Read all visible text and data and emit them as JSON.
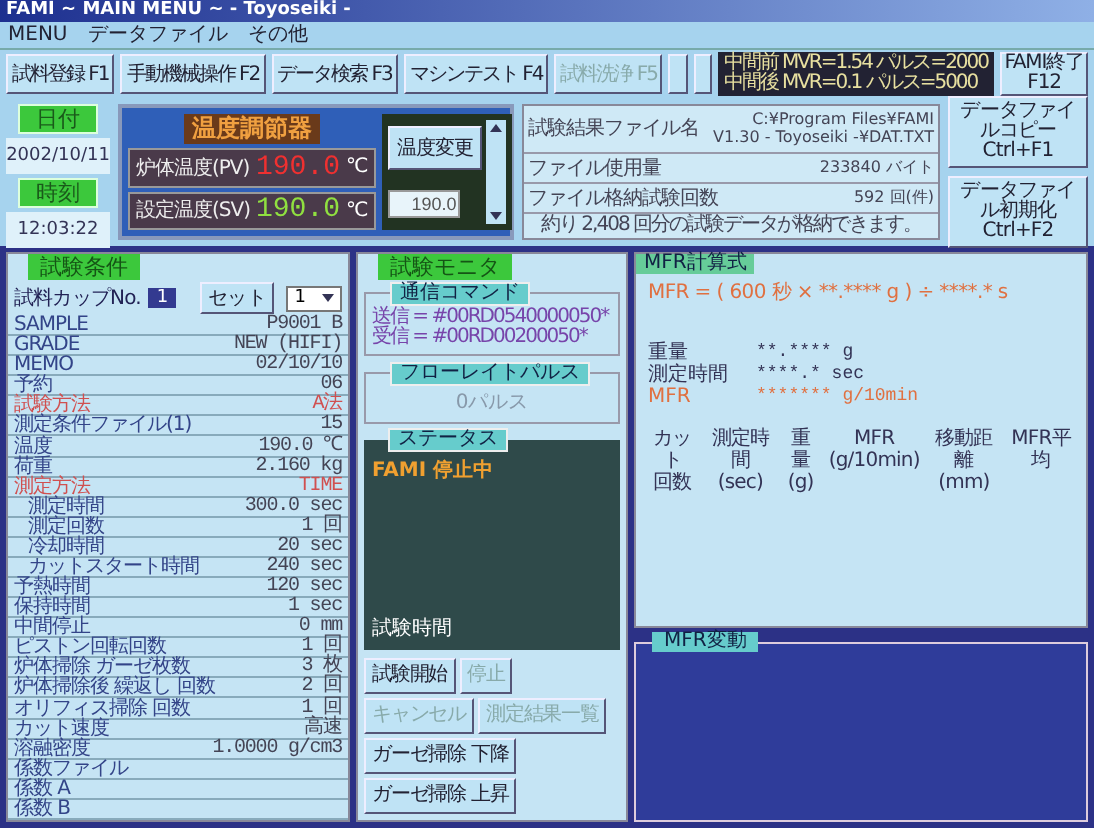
{
  "window": {
    "title": "FAMI ~ MAIN MENU ~ - Toyoseiki -"
  },
  "menu": [
    "MENU",
    "データファイル",
    "その他"
  ],
  "function_keys": [
    {
      "kind": "key",
      "label": "試料登録 F1",
      "disabled": false
    },
    {
      "kind": "key",
      "label": "手動機械操作 F2",
      "disabled": false
    },
    {
      "kind": "key",
      "label": "データ検索 F3",
      "disabled": false
    },
    {
      "kind": "key",
      "label": "マシンテスト F4",
      "disabled": false
    },
    {
      "kind": "key",
      "label": "試料洗浄 F5",
      "disabled": true
    },
    {
      "kind": "empty"
    },
    {
      "kind": "empty"
    }
  ],
  "pulse_info": [
    "中間前 MVR=1.54 パルス=2000",
    "中間後 MVR=0.1 パルス=5000"
  ],
  "exit_button": "FAMI終了 F12",
  "date": {
    "label": "日付",
    "value": "2002/10/11"
  },
  "time": {
    "label": "時刻",
    "value": "12:03:22"
  },
  "temperature_controller": {
    "title": "温度調節器",
    "rows": [
      {
        "kind": "pv",
        "label": "炉体温度(PV)",
        "value": "190.0",
        "unit": "℃"
      },
      {
        "kind": "sv",
        "label": "設定温度(SV)",
        "value": "190.0",
        "unit": "℃"
      }
    ],
    "change_button": "温度変更",
    "setpoint": "190.0"
  },
  "file_info": {
    "rows": [
      {
        "label": "試験結果ファイル名",
        "value": "C:¥Program Files¥FAMI V1.30 - Toyoseiki -¥DAT.TXT"
      },
      {
        "label": "ファイル使用量",
        "value": "233840 バイト"
      },
      {
        "label": "ファイル格納試験回数",
        "value": "592 回(件)"
      }
    ],
    "note": "約り 2,408 回分の試験データが格納できます。",
    "buttons": [
      "データファイルコピー Ctrl+F1",
      "データファイル初期化 Ctrl+F2"
    ]
  },
  "test_conditions": {
    "title": "試験条件",
    "cup_label": "試料カップNo.",
    "cup_number": "1",
    "set_button": "セット",
    "cup_select": "1",
    "rows": [
      {
        "label": "SAMPLE",
        "value": "P9001 B",
        "emphasis": false
      },
      {
        "label": "GRADE",
        "value": "NEW (HIFI)",
        "emphasis": false
      },
      {
        "label": "MEMO",
        "value": "02/10/10",
        "emphasis": false
      },
      {
        "label": "予約",
        "value": "06",
        "emphasis": false
      },
      {
        "label": "試験方法",
        "value": "A法",
        "emphasis": true
      },
      {
        "label": "測定条件ファイル(1)",
        "value": "15",
        "emphasis": false
      },
      {
        "label": "温度",
        "value": "190.0 ℃",
        "emphasis": false
      },
      {
        "label": "荷重",
        "value": "2.160 kg",
        "emphasis": false
      },
      {
        "label": "測定方法",
        "value": "TIME",
        "emphasis": true,
        "children": [
          {
            "label": "測定時間",
            "value": "300.0 sec",
            "emphasis": false
          },
          {
            "label": "測定回数",
            "value": "1 回",
            "emphasis": false
          },
          {
            "label": "冷却時間",
            "value": "20 sec",
            "emphasis": false
          },
          {
            "label": "カットスタート時間",
            "value": "240 sec",
            "emphasis": false
          }
        ]
      },
      {
        "label": "予熱時間",
        "value": "120 sec",
        "emphasis": false
      },
      {
        "label": "保持時間",
        "value": "1 sec",
        "emphasis": false
      },
      {
        "label": "中間停止",
        "value": "0 mm",
        "emphasis": false
      },
      {
        "label": "ピストン回転回数",
        "value": "1 回",
        "emphasis": false
      },
      {
        "label": "炉体掃除 ガーゼ枚数",
        "value": "3 枚",
        "emphasis": false
      },
      {
        "label": "炉体掃除後 繰返し 回数",
        "value": "2 回",
        "emphasis": false
      },
      {
        "label": "オリフィス掃除 回数",
        "value": "1 回",
        "emphasis": false
      },
      {
        "label": "カット速度",
        "value": "高速",
        "emphasis": false
      },
      {
        "label": "溶融密度",
        "value": "1.0000 g/cm3",
        "emphasis": false
      },
      {
        "label": "係数ファイル",
        "emphasis": false
      },
      {
        "label": "係数 A",
        "emphasis": false
      },
      {
        "label": "係数 B",
        "emphasis": false
      }
    ]
  },
  "monitor": {
    "title": "試験モニタ",
    "command": {
      "title": "通信コマンド",
      "lines": [
        "送信 = #00RD0540000050*",
        "受信 = #00RD00200050*"
      ]
    },
    "flow": {
      "title": "フローレイトパルス",
      "value": "0パルス"
    },
    "status": {
      "title": "ステータス",
      "state": "FAMI 停止中",
      "timer_label": "試験時間"
    },
    "buttons": [
      {
        "label": "試験開始",
        "disabled": false
      },
      {
        "label": "停止",
        "disabled": true
      },
      {
        "label": "キャンセル",
        "disabled": true
      },
      {
        "label": "測定結果一覧",
        "disabled": true
      },
      {
        "label": "ガーゼ掃除 下降",
        "disabled": false
      },
      {
        "label": "ガーゼ掃除 上昇",
        "disabled": false
      }
    ]
  },
  "mfr": {
    "title": "MFR計算式",
    "formula": "MFR = ( 600 秒 × **.**** g ) ÷ ****.* s",
    "values": [
      {
        "label": "重量",
        "value": "**.**** g",
        "emphasis": false
      },
      {
        "label": "測定時間",
        "value": "****.* sec",
        "emphasis": false
      },
      {
        "label": "MFR",
        "value": "******* g/10min",
        "emphasis": true
      }
    ],
    "columns": [
      {
        "name": "カット",
        "unit": "回数"
      },
      {
        "name": "測定時間",
        "unit": "(sec)"
      },
      {
        "name": "重量",
        "unit": "(g)"
      },
      {
        "name": "MFR",
        "unit": "(g/10min)"
      },
      {
        "name": "移動距離",
        "unit": "(mm)"
      },
      {
        "name": "MFR平均"
      }
    ]
  },
  "mfr_chart": {
    "title": "MFR変動"
  }
}
